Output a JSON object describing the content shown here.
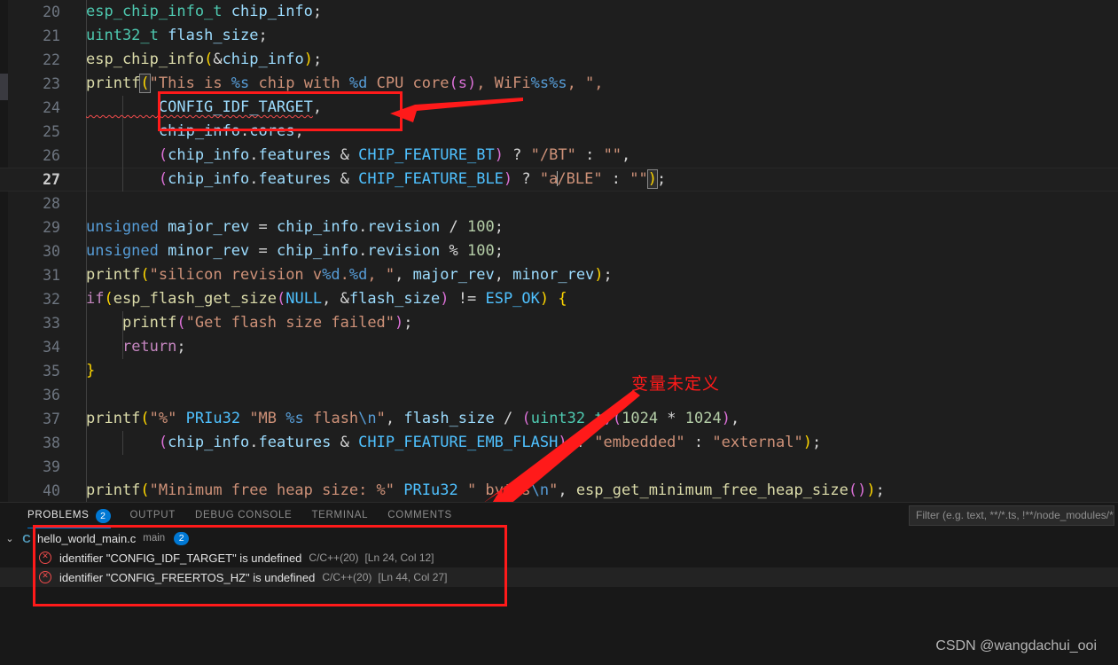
{
  "editor": {
    "language": "c",
    "first_line": 20,
    "current_line": 27,
    "lines": [
      {
        "n": "20",
        "indent_guides": 1,
        "tokens": [
          {
            "t": "esp_chip_info_t",
            "c": "t-type"
          },
          {
            "t": " ",
            "c": "t-plain"
          },
          {
            "t": "chip_info",
            "c": "t-var"
          },
          {
            "t": ";",
            "c": "t-plain"
          }
        ]
      },
      {
        "n": "21",
        "indent_guides": 1,
        "tokens": [
          {
            "t": "uint32_t",
            "c": "t-type"
          },
          {
            "t": " ",
            "c": "t-plain"
          },
          {
            "t": "flash_size",
            "c": "t-var"
          },
          {
            "t": ";",
            "c": "t-plain"
          }
        ]
      },
      {
        "n": "22",
        "indent_guides": 1,
        "tokens": [
          {
            "t": "esp_chip_info",
            "c": "t-fn"
          },
          {
            "t": "(",
            "c": "t-p1"
          },
          {
            "t": "&",
            "c": "t-op"
          },
          {
            "t": "chip_info",
            "c": "t-var"
          },
          {
            "t": ")",
            "c": "t-p1"
          },
          {
            "t": ";",
            "c": "t-plain"
          }
        ]
      },
      {
        "n": "23",
        "indent_guides": 1,
        "tokens": [
          {
            "t": "printf",
            "c": "t-fn"
          },
          {
            "t": "(",
            "c": "t-p1",
            "bracket": true
          },
          {
            "t": "\"This is ",
            "c": "t-str"
          },
          {
            "t": "%s",
            "c": "t-fmt"
          },
          {
            "t": " chip with ",
            "c": "t-str"
          },
          {
            "t": "%d",
            "c": "t-fmt"
          },
          {
            "t": " CPU core",
            "c": "t-str"
          },
          {
            "t": "(s)",
            "c": "t-p2"
          },
          {
            "t": ", WiFi",
            "c": "t-str"
          },
          {
            "t": "%s%s",
            "c": "t-fmt"
          },
          {
            "t": ", \",",
            "c": "t-str"
          }
        ]
      },
      {
        "n": "24",
        "indent_guides": 2,
        "tokens": [
          {
            "t": "        CONFIG_IDF_TARGET",
            "c": "t-var",
            "squiggle": true
          },
          {
            "t": ",",
            "c": "t-plain"
          }
        ]
      },
      {
        "n": "25",
        "indent_guides": 2,
        "tokens": [
          {
            "t": "        chip_info",
            "c": "t-var"
          },
          {
            "t": ".",
            "c": "t-plain"
          },
          {
            "t": "cores",
            "c": "t-var"
          },
          {
            "t": ",",
            "c": "t-plain"
          }
        ]
      },
      {
        "n": "26",
        "indent_guides": 2,
        "tokens": [
          {
            "t": "        ",
            "c": "t-plain"
          },
          {
            "t": "(",
            "c": "t-p2"
          },
          {
            "t": "chip_info",
            "c": "t-var"
          },
          {
            "t": ".",
            "c": "t-plain"
          },
          {
            "t": "features",
            "c": "t-var"
          },
          {
            "t": " ",
            "c": "t-plain"
          },
          {
            "t": "&",
            "c": "t-op"
          },
          {
            "t": " ",
            "c": "t-plain"
          },
          {
            "t": "CHIP_FEATURE_BT",
            "c": "t-const"
          },
          {
            "t": ")",
            "c": "t-p2"
          },
          {
            "t": " ? ",
            "c": "t-op"
          },
          {
            "t": "\"/BT\"",
            "c": "t-str"
          },
          {
            "t": " : ",
            "c": "t-op"
          },
          {
            "t": "\"\"",
            "c": "t-str"
          },
          {
            "t": ",",
            "c": "t-plain"
          }
        ]
      },
      {
        "n": "27",
        "indent_guides": 2,
        "current": true,
        "tokens": [
          {
            "t": "        ",
            "c": "t-plain"
          },
          {
            "t": "(",
            "c": "t-p2"
          },
          {
            "t": "chip_info",
            "c": "t-var"
          },
          {
            "t": ".",
            "c": "t-plain"
          },
          {
            "t": "features",
            "c": "t-var"
          },
          {
            "t": " ",
            "c": "t-plain"
          },
          {
            "t": "&",
            "c": "t-op"
          },
          {
            "t": " ",
            "c": "t-plain"
          },
          {
            "t": "CHIP_FEATURE_BLE",
            "c": "t-const"
          },
          {
            "t": ")",
            "c": "t-p2"
          },
          {
            "t": " ? ",
            "c": "t-op"
          },
          {
            "t": "\"a",
            "c": "t-str"
          },
          {
            "t": "CARET",
            "c": "caret"
          },
          {
            "t": "/BLE\"",
            "c": "t-str"
          },
          {
            "t": " : ",
            "c": "t-op"
          },
          {
            "t": "\"\"",
            "c": "t-str"
          },
          {
            "t": ")",
            "c": "t-p1",
            "bracket": true
          },
          {
            "t": ";",
            "c": "t-plain"
          }
        ]
      },
      {
        "n": "28",
        "indent_guides": 1,
        "tokens": []
      },
      {
        "n": "29",
        "indent_guides": 1,
        "tokens": [
          {
            "t": "unsigned",
            "c": "t-kw2"
          },
          {
            "t": " ",
            "c": "t-plain"
          },
          {
            "t": "major_rev",
            "c": "t-var"
          },
          {
            "t": " = ",
            "c": "t-op"
          },
          {
            "t": "chip_info",
            "c": "t-var"
          },
          {
            "t": ".",
            "c": "t-plain"
          },
          {
            "t": "revision",
            "c": "t-var"
          },
          {
            "t": " / ",
            "c": "t-op"
          },
          {
            "t": "100",
            "c": "t-num"
          },
          {
            "t": ";",
            "c": "t-plain"
          }
        ]
      },
      {
        "n": "30",
        "indent_guides": 1,
        "tokens": [
          {
            "t": "unsigned",
            "c": "t-kw2"
          },
          {
            "t": " ",
            "c": "t-plain"
          },
          {
            "t": "minor_rev",
            "c": "t-var"
          },
          {
            "t": " = ",
            "c": "t-op"
          },
          {
            "t": "chip_info",
            "c": "t-var"
          },
          {
            "t": ".",
            "c": "t-plain"
          },
          {
            "t": "revision",
            "c": "t-var"
          },
          {
            "t": " % ",
            "c": "t-op"
          },
          {
            "t": "100",
            "c": "t-num"
          },
          {
            "t": ";",
            "c": "t-plain"
          }
        ]
      },
      {
        "n": "31",
        "indent_guides": 1,
        "tokens": [
          {
            "t": "printf",
            "c": "t-fn"
          },
          {
            "t": "(",
            "c": "t-p1"
          },
          {
            "t": "\"silicon revision v",
            "c": "t-str"
          },
          {
            "t": "%d",
            "c": "t-fmt"
          },
          {
            "t": ".",
            "c": "t-str"
          },
          {
            "t": "%d",
            "c": "t-fmt"
          },
          {
            "t": ", \"",
            "c": "t-str"
          },
          {
            "t": ", ",
            "c": "t-plain"
          },
          {
            "t": "major_rev",
            "c": "t-var"
          },
          {
            "t": ", ",
            "c": "t-plain"
          },
          {
            "t": "minor_rev",
            "c": "t-var"
          },
          {
            "t": ")",
            "c": "t-p1"
          },
          {
            "t": ";",
            "c": "t-plain"
          }
        ]
      },
      {
        "n": "32",
        "indent_guides": 1,
        "tokens": [
          {
            "t": "if",
            "c": "t-kw"
          },
          {
            "t": "(",
            "c": "t-p1"
          },
          {
            "t": "esp_flash_get_size",
            "c": "t-fn"
          },
          {
            "t": "(",
            "c": "t-p2"
          },
          {
            "t": "NULL",
            "c": "t-const"
          },
          {
            "t": ", ",
            "c": "t-plain"
          },
          {
            "t": "&",
            "c": "t-op"
          },
          {
            "t": "flash_size",
            "c": "t-var"
          },
          {
            "t": ")",
            "c": "t-p2"
          },
          {
            "t": " != ",
            "c": "t-op"
          },
          {
            "t": "ESP_OK",
            "c": "t-const"
          },
          {
            "t": ")",
            "c": "t-p1"
          },
          {
            "t": " ",
            "c": "t-plain"
          },
          {
            "t": "{",
            "c": "t-p1"
          }
        ]
      },
      {
        "n": "33",
        "indent_guides": 2,
        "tokens": [
          {
            "t": "    ",
            "c": "t-plain"
          },
          {
            "t": "printf",
            "c": "t-fn"
          },
          {
            "t": "(",
            "c": "t-p2"
          },
          {
            "t": "\"Get flash size failed\"",
            "c": "t-str"
          },
          {
            "t": ")",
            "c": "t-p2"
          },
          {
            "t": ";",
            "c": "t-plain"
          }
        ]
      },
      {
        "n": "34",
        "indent_guides": 2,
        "tokens": [
          {
            "t": "    ",
            "c": "t-plain"
          },
          {
            "t": "return",
            "c": "t-kw"
          },
          {
            "t": ";",
            "c": "t-plain"
          }
        ]
      },
      {
        "n": "35",
        "indent_guides": 1,
        "tokens": [
          {
            "t": "}",
            "c": "t-p1"
          }
        ]
      },
      {
        "n": "36",
        "indent_guides": 1,
        "tokens": []
      },
      {
        "n": "37",
        "indent_guides": 1,
        "tokens": [
          {
            "t": "printf",
            "c": "t-fn"
          },
          {
            "t": "(",
            "c": "t-p1"
          },
          {
            "t": "\"%\"",
            "c": "t-str"
          },
          {
            "t": " ",
            "c": "t-plain"
          },
          {
            "t": "PRIu32",
            "c": "t-const"
          },
          {
            "t": " ",
            "c": "t-plain"
          },
          {
            "t": "\"MB ",
            "c": "t-str"
          },
          {
            "t": "%s",
            "c": "t-fmt"
          },
          {
            "t": " flash",
            "c": "t-str"
          },
          {
            "t": "\\n",
            "c": "t-fmt"
          },
          {
            "t": "\"",
            "c": "t-str"
          },
          {
            "t": ", ",
            "c": "t-plain"
          },
          {
            "t": "flash_size",
            "c": "t-var"
          },
          {
            "t": " / ",
            "c": "t-op"
          },
          {
            "t": "(",
            "c": "t-p2"
          },
          {
            "t": "uint32_t",
            "c": "t-type"
          },
          {
            "t": ")",
            "c": "t-p2"
          },
          {
            "t": "(",
            "c": "t-p2"
          },
          {
            "t": "1024",
            "c": "t-num"
          },
          {
            "t": " * ",
            "c": "t-op"
          },
          {
            "t": "1024",
            "c": "t-num"
          },
          {
            "t": ")",
            "c": "t-p2"
          },
          {
            "t": ",",
            "c": "t-plain"
          }
        ]
      },
      {
        "n": "38",
        "indent_guides": 2,
        "tokens": [
          {
            "t": "        ",
            "c": "t-plain"
          },
          {
            "t": "(",
            "c": "t-p2"
          },
          {
            "t": "chip_info",
            "c": "t-var"
          },
          {
            "t": ".",
            "c": "t-plain"
          },
          {
            "t": "features",
            "c": "t-var"
          },
          {
            "t": " ",
            "c": "t-plain"
          },
          {
            "t": "&",
            "c": "t-op"
          },
          {
            "t": " ",
            "c": "t-plain"
          },
          {
            "t": "CHIP_FEATURE_EMB_FLASH",
            "c": "t-const"
          },
          {
            "t": ")",
            "c": "t-p2"
          },
          {
            "t": " ? ",
            "c": "t-op"
          },
          {
            "t": "\"embedded\"",
            "c": "t-str"
          },
          {
            "t": " : ",
            "c": "t-op"
          },
          {
            "t": "\"external\"",
            "c": "t-str"
          },
          {
            "t": ")",
            "c": "t-p1"
          },
          {
            "t": ";",
            "c": "t-plain"
          }
        ]
      },
      {
        "n": "39",
        "indent_guides": 1,
        "tokens": []
      },
      {
        "n": "40",
        "indent_guides": 1,
        "clipped": true,
        "tokens": [
          {
            "t": "printf",
            "c": "t-fn"
          },
          {
            "t": "(",
            "c": "t-p1"
          },
          {
            "t": "\"Minimum free heap size: %\"",
            "c": "t-str"
          },
          {
            "t": " ",
            "c": "t-plain"
          },
          {
            "t": "PRIu32",
            "c": "t-const"
          },
          {
            "t": " ",
            "c": "t-plain"
          },
          {
            "t": "\" bytes",
            "c": "t-str"
          },
          {
            "t": "\\n",
            "c": "t-fmt"
          },
          {
            "t": "\"",
            "c": "t-str"
          },
          {
            "t": ", ",
            "c": "t-plain"
          },
          {
            "t": "esp_get_minimum_free_heap_size",
            "c": "t-fn"
          },
          {
            "t": "(",
            "c": "t-p2"
          },
          {
            "t": ")",
            "c": "t-p2"
          },
          {
            "t": ")",
            "c": "t-p1"
          },
          {
            "t": ";",
            "c": "t-plain"
          }
        ]
      }
    ]
  },
  "annotations": {
    "accent_color": "#ff1a1a",
    "chinese_note": "变量未定义",
    "code_box_target": "CONFIG_IDF_TARGET,",
    "problem_box_target": "problems-error-list"
  },
  "panel": {
    "tabs": [
      {
        "id": "problems",
        "label": "PROBLEMS",
        "active": true,
        "badge": "2"
      },
      {
        "id": "output",
        "label": "OUTPUT",
        "active": false,
        "badge": ""
      },
      {
        "id": "debug-console",
        "label": "DEBUG CONSOLE",
        "active": false,
        "badge": ""
      },
      {
        "id": "terminal",
        "label": "TERMINAL",
        "active": false,
        "badge": ""
      },
      {
        "id": "comments",
        "label": "COMMENTS",
        "active": false,
        "badge": ""
      }
    ],
    "filter": {
      "value": "",
      "placeholder": "Filter (e.g. text, **/*.ts, !**/node_modules/**)"
    },
    "problems": {
      "file": {
        "twisty": "⌄",
        "icon_letter": "C",
        "name": "hello_world_main.c",
        "directory": "main",
        "count": "2"
      },
      "errors": [
        {
          "icon": "error-icon",
          "message": "identifier \"CONFIG_IDF_TARGET\" is undefined",
          "source": "C/C++(20)",
          "position": "[Ln 24, Col 12]",
          "highlighted": false
        },
        {
          "icon": "error-icon",
          "message": "identifier \"CONFIG_FREERTOS_HZ\" is undefined",
          "source": "C/C++(20)",
          "position": "[Ln 44, Col 27]",
          "highlighted": true
        }
      ]
    }
  },
  "watermark": {
    "text": "CSDN @wangdachui_ooi"
  }
}
